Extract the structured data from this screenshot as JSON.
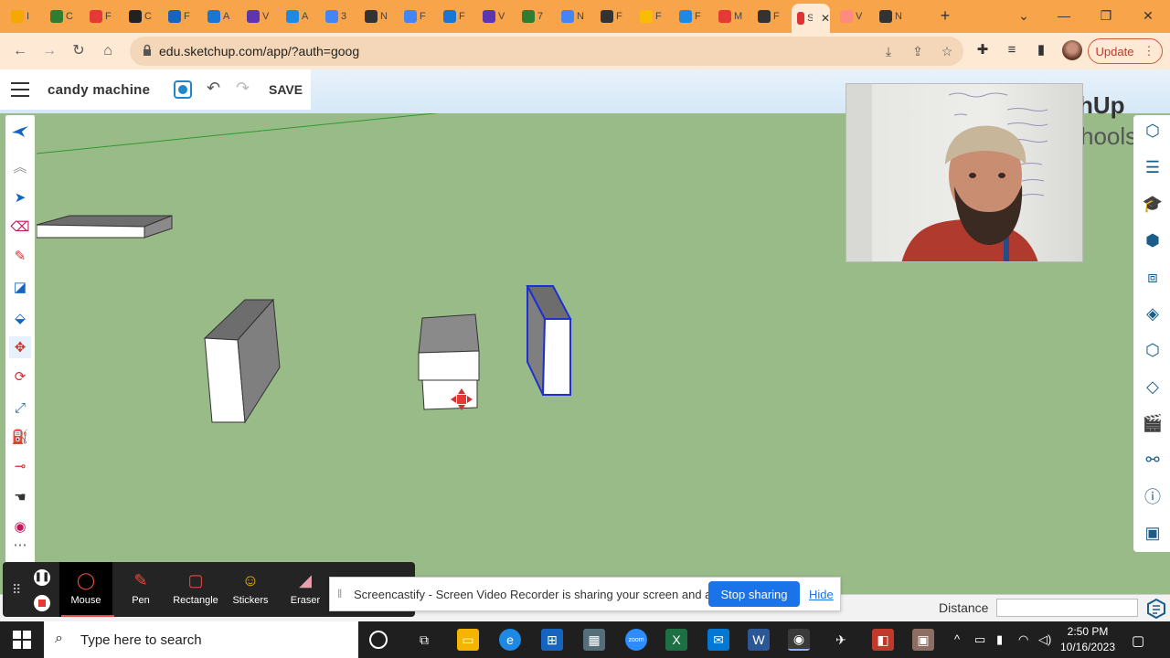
{
  "browser": {
    "tabs": [
      {
        "letter": "I",
        "color": "#f4a800"
      },
      {
        "letter": "C",
        "color": "#2e7d32"
      },
      {
        "letter": "F",
        "color": "#e53935"
      },
      {
        "letter": "C",
        "color": "#222222"
      },
      {
        "letter": "F",
        "color": "#1565c0"
      },
      {
        "letter": "A",
        "color": "#1976d2"
      },
      {
        "letter": "V",
        "color": "#5e35b1"
      },
      {
        "letter": "A",
        "color": "#1e88e5"
      },
      {
        "letter": "3",
        "color": "#4285f4"
      },
      {
        "letter": "N",
        "color": "#333333"
      },
      {
        "letter": "F",
        "color": "#4285f4"
      },
      {
        "letter": "F",
        "color": "#1976d2"
      },
      {
        "letter": "V",
        "color": "#5e35b1"
      },
      {
        "letter": "7",
        "color": "#2e7d32"
      },
      {
        "letter": "N",
        "color": "#4285f4"
      },
      {
        "letter": "F",
        "color": "#333333"
      },
      {
        "letter": "F",
        "color": "#fbbc04"
      },
      {
        "letter": "F",
        "color": "#1e88e5"
      },
      {
        "letter": "M",
        "color": "#e53935"
      },
      {
        "letter": "F",
        "color": "#333333"
      },
      {
        "letter": "S",
        "color": "#d33",
        "active": true
      },
      {
        "letter": "V",
        "color": "#ff8a80"
      },
      {
        "letter": "N",
        "color": "#333333"
      }
    ],
    "active_tab_label": "S",
    "url": "edu.sketchup.com/app/?auth=goog",
    "update_label": "Update"
  },
  "sketchup": {
    "model_title": "candy machine",
    "save_label": "SAVE",
    "brand_line1": "hUp",
    "brand_line2": "hools",
    "distance_label": "Distance",
    "distance_value": ""
  },
  "screencastify": {
    "tools": [
      {
        "label": "Mouse",
        "icon": "mouse-icon"
      },
      {
        "label": "Pen",
        "icon": "pen-icon"
      },
      {
        "label": "Rectangle",
        "icon": "rectangle-icon"
      },
      {
        "label": "Stickers",
        "icon": "sticker-icon"
      },
      {
        "label": "Eraser",
        "icon": "eraser-icon"
      }
    ],
    "share_text": "Screencastify - Screen Video Recorder is sharing your screen and audio.",
    "stop_label": "Stop sharing",
    "hide_label": "Hide"
  },
  "taskbar": {
    "search_placeholder": "Type here to search",
    "time": "2:50 PM",
    "date": "10/16/2023"
  },
  "colors": {
    "canvas": "#99bb88",
    "tabstrip": "#f7a44a",
    "accent": "#1a73e8",
    "selection_blue": "#1f2fd6"
  }
}
